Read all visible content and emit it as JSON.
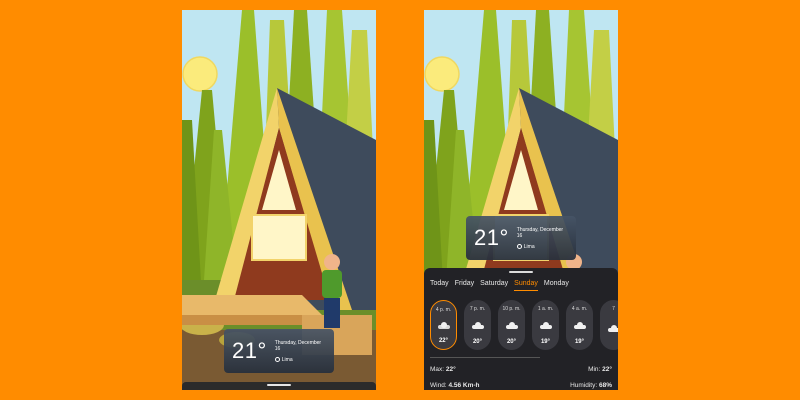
{
  "weather": {
    "temperature": "21°",
    "date": "Thursday, December 16",
    "location": "Lima"
  },
  "forecast": {
    "tabs": [
      {
        "label": "Today"
      },
      {
        "label": "Friday"
      },
      {
        "label": "Saturday"
      },
      {
        "label": "Sunday",
        "active": true
      },
      {
        "label": "Monday"
      }
    ],
    "hours": [
      {
        "time": "4 p. m.",
        "temp": "22°",
        "icon": "partly-cloudy-icon"
      },
      {
        "time": "7 p. m.",
        "temp": "20°",
        "icon": "cloud-icon"
      },
      {
        "time": "10 p. m.",
        "temp": "20°",
        "icon": "cloud-icon"
      },
      {
        "time": "1 a. m.",
        "temp": "19°",
        "icon": "cloud-icon"
      },
      {
        "time": "4 a. m.",
        "temp": "19°",
        "icon": "cloud-icon"
      },
      {
        "time": "7",
        "temp": "",
        "icon": "cloud-icon"
      }
    ],
    "max_label": "Max:",
    "max_value": "22°",
    "min_label": "Min:",
    "min_value": "22°",
    "wind_label": "Wind:",
    "wind_value": "4.56 Km-h",
    "humidity_label": "Humidity:",
    "humidity_value": "68%"
  },
  "colors": {
    "background": "#ff8c00",
    "accent": "#ff8c00",
    "panel": "#222226"
  }
}
